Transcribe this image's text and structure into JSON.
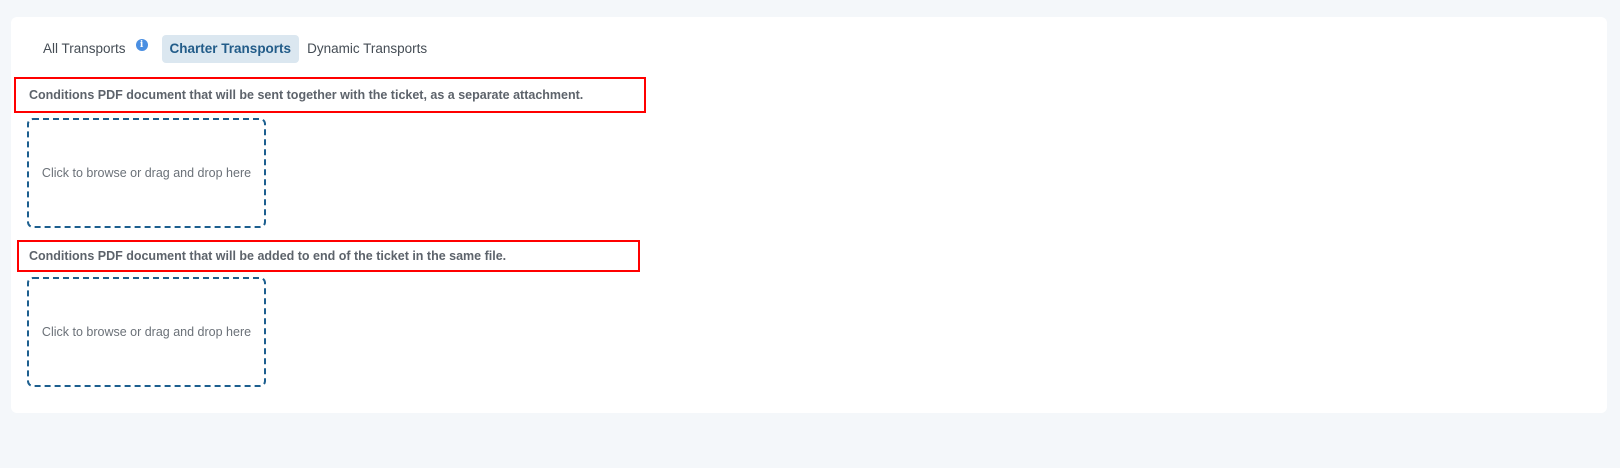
{
  "tabs": [
    {
      "label": "All Transports",
      "active": false
    },
    {
      "label": "Charter Transports",
      "active": true
    },
    {
      "label": "Dynamic Transports",
      "active": false
    }
  ],
  "info_icon": {
    "glyph": "i",
    "color": "#4a8fe2"
  },
  "sections": [
    {
      "label": "Conditions PDF document that will be sent together with the ticket, as a separate attachment.",
      "dropzone_text": "Click to browse or drag and drop here"
    },
    {
      "label": "Conditions PDF document that will be added to end of the ticket in the same file.",
      "dropzone_text": "Click to browse or drag and drop here"
    }
  ],
  "colors": {
    "highlight_border": "#ff0000",
    "active_tab_bg": "#dbe7f0",
    "active_tab_text": "#225c89",
    "dropzone_border": "#1c5f8f",
    "page_bg": "#f4f7fa"
  }
}
